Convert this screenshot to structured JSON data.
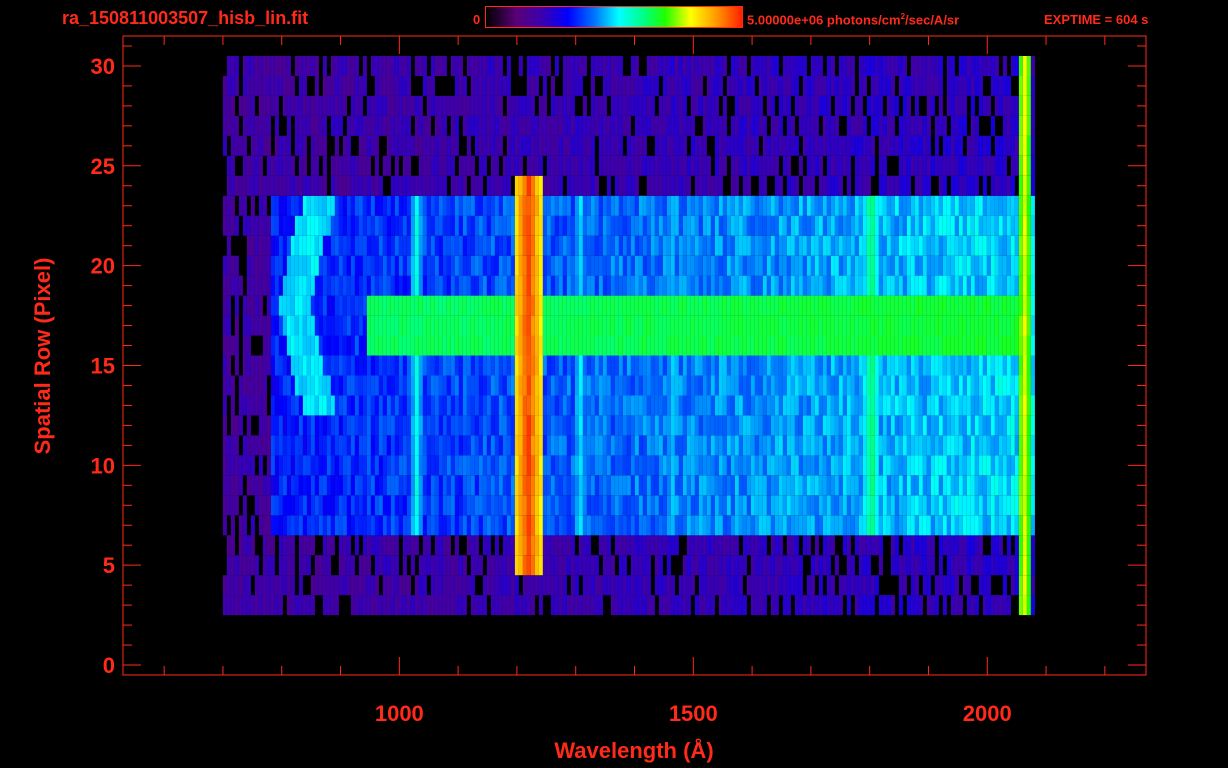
{
  "header": {
    "file_title": "ra_150811003507_hisb_lin.fit",
    "colorbar_min": "0",
    "colorbar_max_prefix": "5.00000e+06 photons/cm",
    "colorbar_max_exp": "2",
    "colorbar_max_suffix": "/sec/A/sr",
    "exptime": "EXPTIME = 604 s"
  },
  "colors": {
    "axis": "#ff2a1a",
    "background": "#000000",
    "colormap": [
      "#000000",
      "#5a0078",
      "#3a00b0",
      "#0000ff",
      "#0070ff",
      "#00ffff",
      "#00ff80",
      "#20ff00",
      "#ffff00",
      "#ff9900",
      "#ff2000"
    ]
  },
  "chart_data": {
    "type": "heatmap",
    "xlabel": "Wavelength (Å)",
    "ylabel": "Spatial Row (Pixel)",
    "xlim": [
      530,
      2270
    ],
    "ylim": [
      -0.5,
      31.5
    ],
    "x_ticks": [
      1000,
      1500,
      2000
    ],
    "y_ticks": [
      0,
      5,
      10,
      15,
      20,
      25,
      30
    ],
    "x_minor_step": 100,
    "y_minor_step": 1,
    "colorbar": {
      "min": 0,
      "max": 5000000,
      "units": "photons/cm^2/sec/A/sr"
    },
    "detector_extent": {
      "x": [
        700,
        2080
      ],
      "y": [
        3,
        30
      ]
    },
    "slit_extent": {
      "x": [
        780,
        2065
      ],
      "y": [
        7,
        23
      ]
    },
    "emission_lines": [
      {
        "wavelength": 1216,
        "rows": [
          5,
          24
        ],
        "peak_fraction": 0.97
      },
      {
        "wavelength": 1026,
        "rows": [
          7,
          23
        ],
        "peak_fraction": 0.52
      },
      {
        "wavelength": 1304,
        "rows": [
          7,
          23
        ],
        "peak_fraction": 0.5
      },
      {
        "wavelength": 1460,
        "rows": [
          7,
          23
        ],
        "peak_fraction": 0.48
      },
      {
        "wavelength": 1800,
        "rows": [
          7,
          23
        ],
        "peak_fraction": 0.62
      },
      {
        "wavelength": 2060,
        "rows": [
          1,
          30
        ],
        "peak_fraction": 0.8
      }
    ],
    "bright_band": {
      "rows": [
        16,
        18
      ],
      "x": [
        940,
        2060
      ],
      "fraction": 0.6
    },
    "crescent": {
      "x": [
        790,
        900
      ],
      "rows": [
        13,
        23
      ],
      "fraction": 0.45
    }
  }
}
